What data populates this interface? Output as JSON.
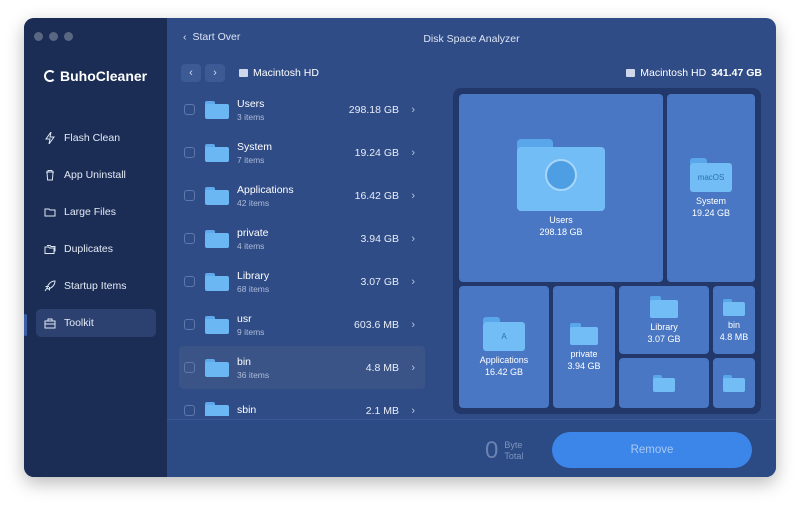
{
  "app": {
    "name": "BuhoCleaner",
    "title": "Disk Space Analyzer",
    "back_label": "Start Over"
  },
  "sidebar": {
    "items": [
      {
        "label": "Flash Clean",
        "icon": "lightning-icon"
      },
      {
        "label": "App Uninstall",
        "icon": "trash-icon"
      },
      {
        "label": "Large Files",
        "icon": "folder-icon"
      },
      {
        "label": "Duplicates",
        "icon": "duplicate-folder-icon"
      },
      {
        "label": "Startup Items",
        "icon": "rocket-icon"
      },
      {
        "label": "Toolkit",
        "icon": "toolkit-icon",
        "active": true
      }
    ]
  },
  "path": {
    "label": "Macintosh HD"
  },
  "disk": {
    "name": "Macintosh HD",
    "size": "341.47 GB"
  },
  "files": [
    {
      "name": "Users",
      "items": "3 items",
      "size": "298.18 GB"
    },
    {
      "name": "System",
      "items": "7 items",
      "size": "19.24 GB"
    },
    {
      "name": "Applications",
      "items": "42 items",
      "size": "16.42 GB"
    },
    {
      "name": "private",
      "items": "4 items",
      "size": "3.94 GB"
    },
    {
      "name": "Library",
      "items": "68 items",
      "size": "3.07 GB"
    },
    {
      "name": "usr",
      "items": "9 items",
      "size": "603.6 MB"
    },
    {
      "name": "bin",
      "items": "36 items",
      "size": "4.8 MB",
      "selected": true
    },
    {
      "name": "sbin",
      "items": "",
      "size": "2.1 MB"
    }
  ],
  "treemap": {
    "users": {
      "name": "Users",
      "size": "298.18 GB"
    },
    "system": {
      "name": "System",
      "size": "19.24 GB",
      "badge": "macOS"
    },
    "applications": {
      "name": "Applications",
      "size": "16.42 GB"
    },
    "private": {
      "name": "private",
      "size": "3.94 GB"
    },
    "library": {
      "name": "Library",
      "size": "3.07 GB"
    },
    "bin": {
      "name": "bin",
      "size": "4.8 MB"
    }
  },
  "footer": {
    "total_value": "0",
    "total_unit": "Byte",
    "total_label": "Total",
    "remove_label": "Remove"
  },
  "colors": {
    "sidebar_bg": "#1b2d55",
    "main_bg": "#2f4c86",
    "accent": "#3c86ea",
    "folder": "#72bdf5"
  }
}
